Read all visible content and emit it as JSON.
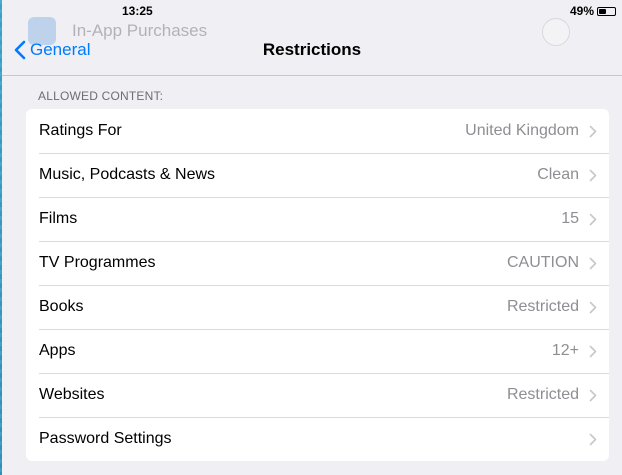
{
  "status_bar": {
    "time": "13:25",
    "battery": "49%",
    "battery_level": 0.49
  },
  "ghost": {
    "label": "In-App Purchases"
  },
  "nav": {
    "back_label": "General",
    "title": "Restrictions"
  },
  "section": {
    "header": "ALLOWED CONTENT:"
  },
  "rows": [
    {
      "label": "Ratings For",
      "value": "United Kingdom"
    },
    {
      "label": "Music, Podcasts & News",
      "value": "Clean"
    },
    {
      "label": "Films",
      "value": "15"
    },
    {
      "label": "TV Programmes",
      "value": "CAUTION"
    },
    {
      "label": "Books",
      "value": "Restricted"
    },
    {
      "label": "Apps",
      "value": "12+"
    },
    {
      "label": "Websites",
      "value": "Restricted"
    },
    {
      "label": "Password Settings",
      "value": ""
    }
  ],
  "colors": {
    "accent": "#007aff",
    "background": "#efeff4",
    "secondary_text": "#8e8e93"
  }
}
